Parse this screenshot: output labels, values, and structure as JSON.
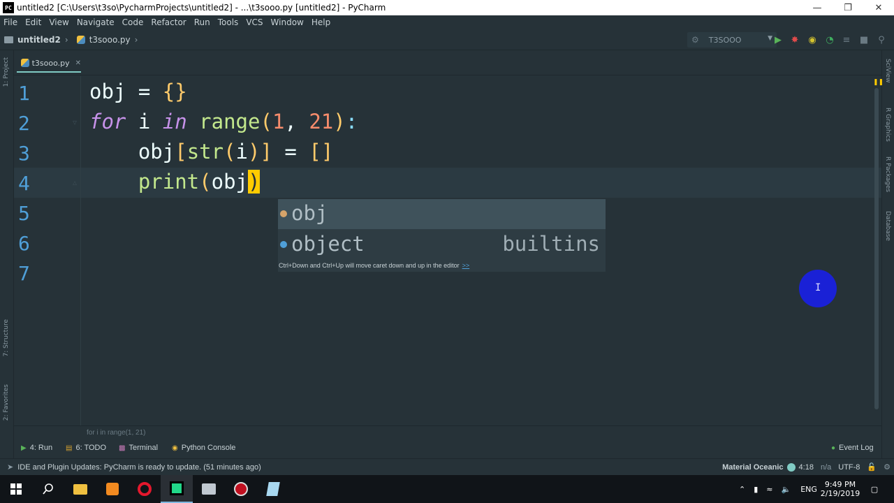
{
  "window": {
    "title": "untitled2 [C:\\Users\\t3so\\PycharmProjects\\untitled2] - ...\\t3sooo.py [untitled2] - PyCharm",
    "app_icon": "PC",
    "controls": [
      "minimize-icon",
      "maximize-icon",
      "close-icon"
    ]
  },
  "menu": {
    "items": [
      {
        "label": "File"
      },
      {
        "label": "Edit"
      },
      {
        "label": "View"
      },
      {
        "label": "Navigate"
      },
      {
        "label": "Code"
      },
      {
        "label": "Refactor"
      },
      {
        "label": "Run"
      },
      {
        "label": "Tools"
      },
      {
        "label": "VCS"
      },
      {
        "label": "Window"
      },
      {
        "label": "Help"
      }
    ]
  },
  "navbar": {
    "project": "untitled2",
    "file": "t3sooo.py",
    "run_config": "T3SOOO"
  },
  "left_stripe": {
    "project": "1: Project",
    "structure": "7: Structure",
    "favorites": "2: Favorites"
  },
  "right_stripe": {
    "sciview": "SciView",
    "rgraphics": "R Graphics",
    "rpackages": "R Packages",
    "database": "Database"
  },
  "tab": {
    "label": "t3sooo.py"
  },
  "editor": {
    "line_numbers": [
      "1",
      "2",
      "3",
      "4",
      "5",
      "6",
      "7"
    ],
    "lines": [
      "obj = {}",
      "for i in range(1, 21):",
      "    obj[str(i)] = []",
      "    print(obj)"
    ]
  },
  "completion": {
    "items": [
      {
        "name": "obj",
        "source": ""
      },
      {
        "name": "object",
        "source": "builtins"
      }
    ],
    "hint": "Ctrl+Down and Ctrl+Up will move caret down and up in the editor",
    "hint_link": ">>"
  },
  "editor_breadcrumb": "for i in range(1, 21)",
  "tool_windows": {
    "run": "4: Run",
    "todo": "6: TODO",
    "terminal": "Terminal",
    "python_console": "Python Console",
    "event_log": "Event Log"
  },
  "status": {
    "message": "IDE and Plugin Updates: PyCharm is ready to update. (51 minutes ago)",
    "theme": "Material Oceanic",
    "position": "4:18",
    "line_sep": "n/a",
    "encoding": "UTF-8"
  },
  "taskbar": {
    "language": "ENG",
    "time": "9:49 PM",
    "date": "2/19/2019"
  },
  "colors": {
    "editor_bg": "#263238",
    "keyword": "#c792ea",
    "function": "#c3e88d",
    "number": "#f78c6c",
    "bracket": "#ffcb6b",
    "line_number": "#4f9fd8"
  }
}
